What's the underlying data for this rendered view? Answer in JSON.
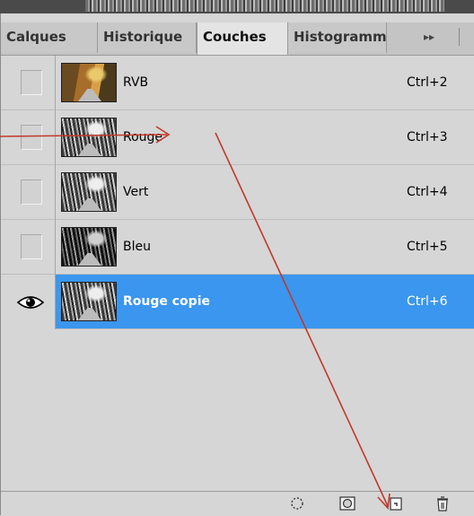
{
  "tabs": [
    {
      "label": "Calques",
      "active": false
    },
    {
      "label": "Historique",
      "active": false
    },
    {
      "label": "Couches",
      "active": true
    },
    {
      "label": "Histogramme",
      "active": false
    }
  ],
  "tab_menu_glyph": "▸▸",
  "channels": [
    {
      "name": "RVB",
      "shortcut": "Ctrl+2",
      "visible": false,
      "selected": false,
      "thumb": "color-icon"
    },
    {
      "name": "Rouge",
      "shortcut": "Ctrl+3",
      "visible": false,
      "selected": false,
      "thumb": "grayscale-icon"
    },
    {
      "name": "Vert",
      "shortcut": "Ctrl+4",
      "visible": false,
      "selected": false,
      "thumb": "grayscale-icon"
    },
    {
      "name": "Bleu",
      "shortcut": "Ctrl+5",
      "visible": false,
      "selected": false,
      "thumb": "grayscale-dark-icon"
    },
    {
      "name": "Rouge copie",
      "shortcut": "Ctrl+6",
      "visible": true,
      "selected": true,
      "thumb": "grayscale-icon"
    }
  ],
  "bottom_icons": [
    "load-selection-icon",
    "save-selection-icon",
    "new-channel-icon",
    "delete-channel-icon"
  ],
  "colors": {
    "selection": "#3a96ee",
    "panel": "#d6d6d6",
    "annotation_arrow": "#c0392b"
  }
}
